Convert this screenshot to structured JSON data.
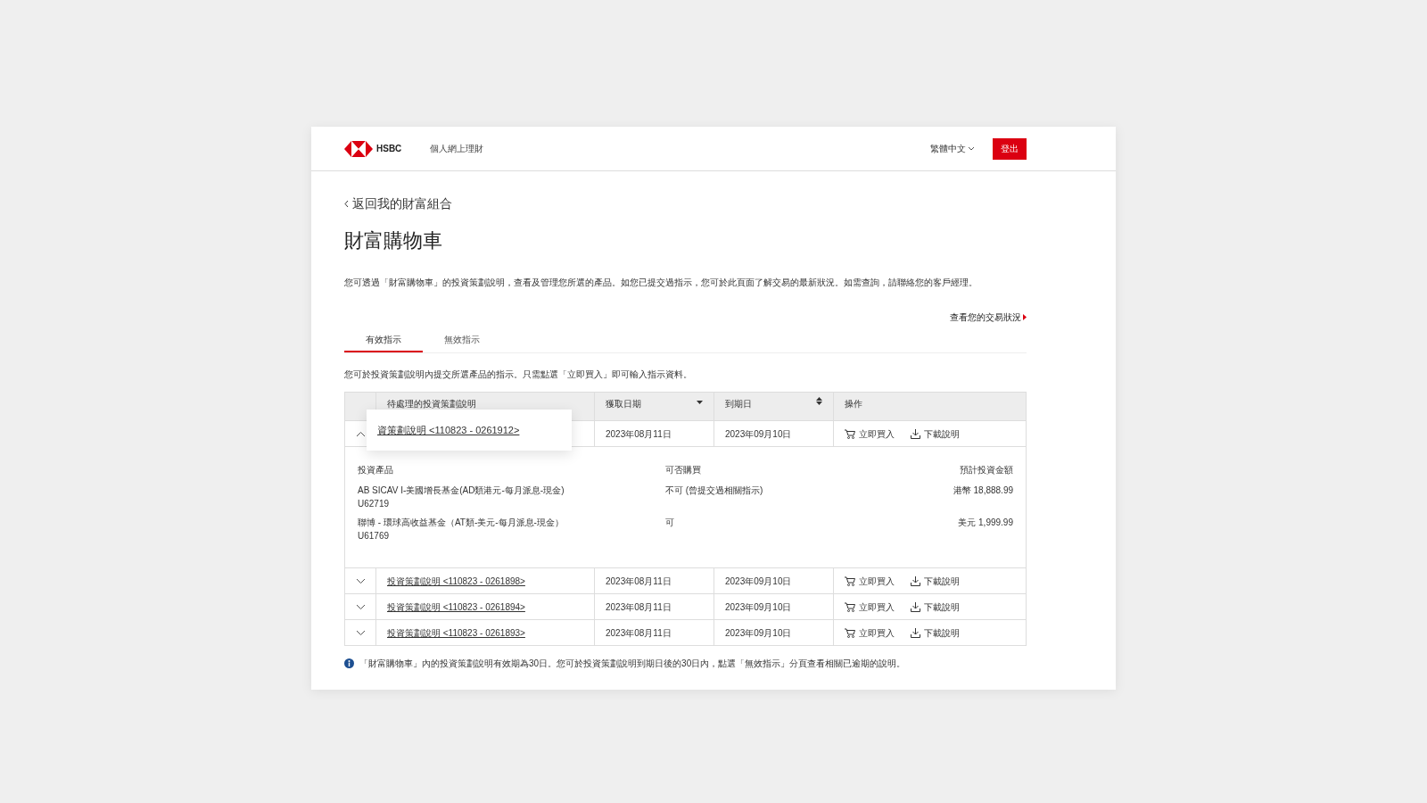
{
  "header": {
    "brand": "HSBC",
    "site_title": "個人網上理財",
    "language": "繁體中文",
    "logout": "登出"
  },
  "back_link": "返回我的財富組合",
  "title": "財富購物車",
  "intro": "您可透過「財富購物車」的投資策劃說明，查看及管理您所選的產品。如您已提交過指示，您可於此頁面了解交易的最新狀況。如需查詢，請聯絡您的客戶經理。",
  "status_link": "查看您的交易狀況",
  "tabs": [
    {
      "label": "有效指示",
      "selected": true
    },
    {
      "label": "無效指示",
      "selected": false
    }
  ],
  "tab_note": "您可於投資策劃說明內提交所選產品的指示。只需點選「立即買入」即可輸入指示資料。",
  "table": {
    "columns": [
      {
        "label": "待處理的投資策劃說明",
        "kind": "plain"
      },
      {
        "label": "獲取日期",
        "kind": "sorted"
      },
      {
        "label": "到期日",
        "kind": "sortable"
      },
      {
        "label": "操作",
        "kind": "plain"
      }
    ],
    "rows": [
      {
        "plan": "資策劃說明 <110823 - 0261912>",
        "obtained": "2023年08月11日",
        "expiry": "2023年09月10日",
        "buy": "立即買入",
        "download": "下載說明",
        "expanded": true,
        "highlighted": true,
        "details": {
          "headers": [
            "投資產品",
            "可否購買",
            "預計投資金額"
          ],
          "products": [
            {
              "name": "AB SICAV I-美國增長基金(AD類港元-每月派息-現金)",
              "code": "U62719",
              "availability": "不可 (曾提交過相關指示)",
              "amount": "港幣 18,888.99"
            },
            {
              "name": "聯博 - 環球高收益基金（AT類-美元-每月派息-現金）",
              "code": "U61769",
              "availability": "可",
              "amount": "美元 1,999.99"
            }
          ]
        }
      },
      {
        "plan": "投資策劃說明 <110823 - 0261898>",
        "obtained": "2023年08月11日",
        "expiry": "2023年09月10日",
        "buy": "立即買入",
        "download": "下載說明",
        "expanded": false,
        "highlighted": false
      },
      {
        "plan": "投資策劃說明 <110823 - 0261894>",
        "obtained": "2023年08月11日",
        "expiry": "2023年09月10日",
        "buy": "立即買入",
        "download": "下載說明",
        "expanded": false,
        "highlighted": false
      },
      {
        "plan": "投資策劃說明 <110823 - 0261893>",
        "obtained": "2023年08月11日",
        "expiry": "2023年09月10日",
        "buy": "立即買入",
        "download": "下載說明",
        "expanded": false,
        "highlighted": false
      }
    ]
  },
  "footer_note": "「財富購物車」內的投資策劃說明有效期為30日。您可於投資策劃說明到期日後的30日內，點選「無效指示」分頁查看相關已逾期的說明。"
}
